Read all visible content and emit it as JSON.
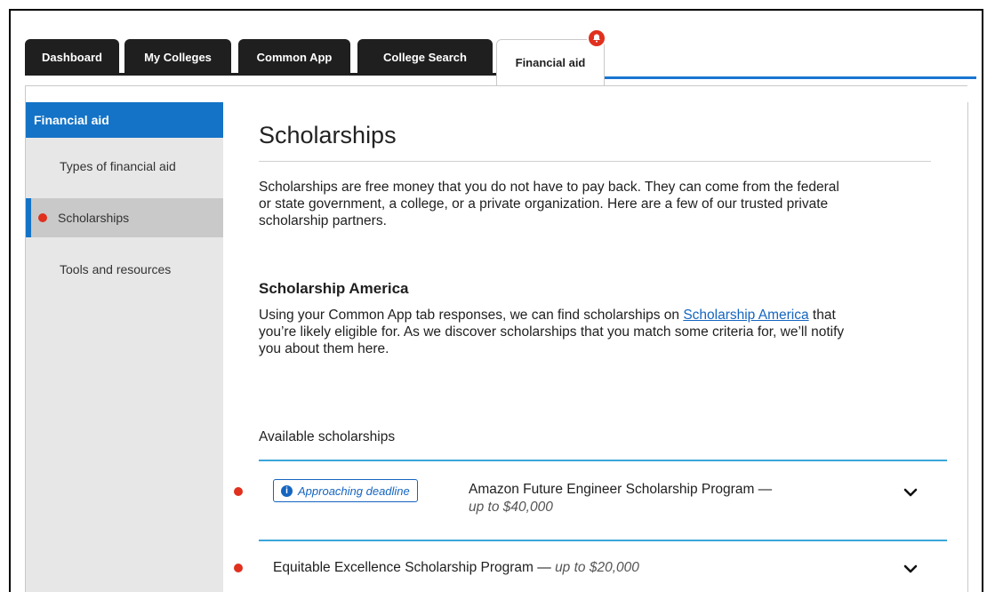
{
  "tabs": [
    {
      "label": "Dashboard"
    },
    {
      "label": "My Colleges"
    },
    {
      "label": "Common App"
    },
    {
      "label": "College Search"
    },
    {
      "label": "Financial aid"
    }
  ],
  "sidebar": {
    "header": "Financial aid",
    "items": [
      {
        "label": "Types of financial aid"
      },
      {
        "label": "Scholarships"
      },
      {
        "label": "Tools and resources"
      }
    ]
  },
  "main": {
    "title": "Scholarships",
    "intro": "Scholarships are free money that you do not have to pay back. They can come from the federal or state government, a college, or a private organization. Here are a few of our trusted private scholarship partners.",
    "section_title": "Scholarship America",
    "section_text_before": "Using your Common App tab responses, we can find scholarships on ",
    "section_link": "Scholarship America",
    "section_text_after": " that you’re likely eligible for. As we discover scholarships that you match some criteria for, we’ll notify you about them here.",
    "available_title": "Available scholarships",
    "scholarships": [
      {
        "badge": "Approaching deadline",
        "name": "Amazon Future Engineer Scholarship Program —",
        "amount": "up to $40,000"
      },
      {
        "name": "Equitable Excellence Scholarship Program —",
        "amount": "up to $20,000"
      }
    ]
  },
  "colors": {
    "primary_blue": "#1473c6",
    "alert_red": "#e0301e",
    "tab_dark": "#1f1f1f",
    "divider_blue": "#3aa6d8"
  }
}
